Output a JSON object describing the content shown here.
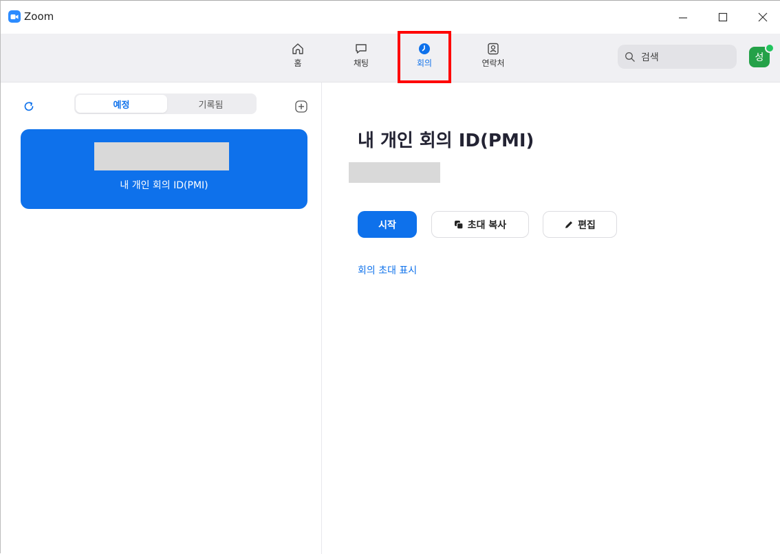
{
  "window": {
    "title": "Zoom",
    "icons": [
      "zoom-logo",
      "minimize-icon",
      "maximize-icon",
      "close-icon"
    ]
  },
  "nav": {
    "tabs": [
      {
        "id": "home",
        "label": "홈",
        "icon": "home-icon",
        "active": false
      },
      {
        "id": "chat",
        "label": "채팅",
        "icon": "chat-icon",
        "active": false
      },
      {
        "id": "meetings",
        "label": "회의",
        "icon": "clock-icon",
        "active": true
      },
      {
        "id": "contacts",
        "label": "연락처",
        "icon": "contacts-icon",
        "active": false
      }
    ],
    "search_placeholder": "검색",
    "avatar_initial": "성",
    "highlight_color": "#ff0000"
  },
  "left_panel": {
    "segments": [
      "예정",
      "기록됨"
    ],
    "selected_segment": "예정",
    "meeting_card": {
      "name": "내 개인 회의 ID(PMI)",
      "selected": true
    }
  },
  "detail": {
    "title": "내 개인 회의 ID(PMI)",
    "start_label": "시작",
    "copy_invite_label": "초대 복사",
    "edit_label": "편집",
    "show_invite_link": "회의 초대 표시"
  },
  "colors": {
    "accent": "#0e71eb",
    "nav_bg": "#f0f0f3",
    "avatar_bg": "#24a148"
  }
}
